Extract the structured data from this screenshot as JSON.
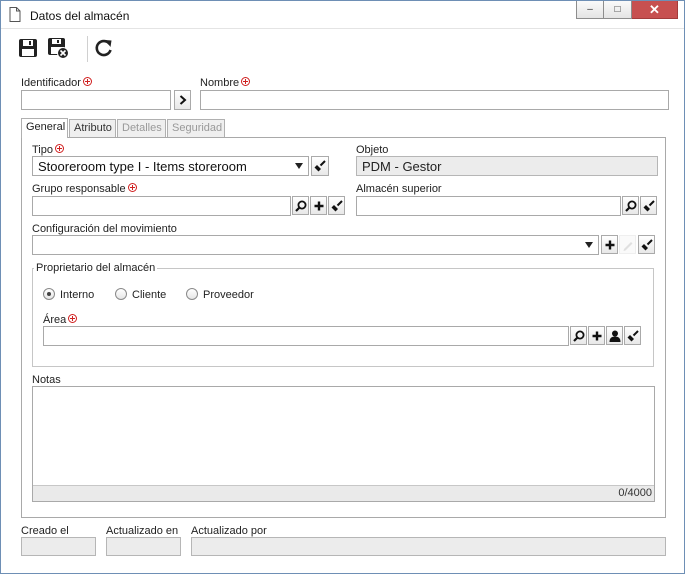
{
  "window": {
    "title": "Datos del almacén",
    "controls": {
      "minimize": "‒",
      "maximize": "□",
      "close": "✕"
    }
  },
  "toolbar": {
    "buttons": [
      {
        "name": "save",
        "icon": "floppy-disk-icon"
      },
      {
        "name": "save-close",
        "icon": "floppy-disk-close-icon"
      },
      {
        "name": "refresh",
        "icon": "refresh-icon"
      }
    ]
  },
  "header": {
    "identificador_label": "Identificador",
    "identificador_value": "",
    "nombre_label": "Nombre",
    "nombre_value": ""
  },
  "tabs": [
    {
      "label": "General",
      "active": true,
      "enabled": true
    },
    {
      "label": "Atributo",
      "active": false,
      "enabled": true
    },
    {
      "label": "Detalles",
      "active": false,
      "enabled": false
    },
    {
      "label": "Seguridad",
      "active": false,
      "enabled": false
    }
  ],
  "general": {
    "tipo_label": "Tipo",
    "tipo_value": "Stooreroom type I - Items storeroom",
    "objeto_label": "Objeto",
    "objeto_value": "PDM - Gestor",
    "grupo_label": "Grupo responsable",
    "grupo_value": "",
    "almacen_superior_label": "Almacén superior",
    "almacen_superior_value": "",
    "config_label": "Configuración del movimiento",
    "config_value": "",
    "propietario_title": "Proprietario del almacén",
    "radios": [
      {
        "label": "Interno",
        "checked": true
      },
      {
        "label": "Cliente",
        "checked": false
      },
      {
        "label": "Proveedor",
        "checked": false
      }
    ],
    "area_label": "Área",
    "area_value": "",
    "notas_label": "Notas",
    "notas_value": "",
    "notas_counter": "0/4000"
  },
  "footer": {
    "creado_label": "Creado el",
    "creado_value": "",
    "actualizado_en_label": "Actualizado en",
    "actualizado_en_value": "",
    "actualizado_por_label": "Actualizado por",
    "actualizado_por_value": ""
  },
  "colors": {
    "required_marker": "#d02020",
    "window_border": "#6e8fb5",
    "close_button": "#c75050",
    "readonly_field": "#ececec"
  }
}
